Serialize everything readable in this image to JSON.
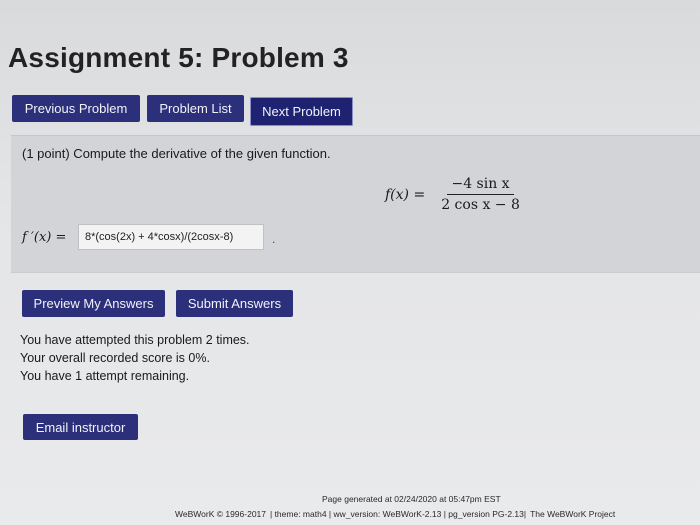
{
  "page": {
    "title": "Assignment 5: Problem 3"
  },
  "nav": {
    "previous": "Previous Problem",
    "list": "Problem List",
    "next": "Next Problem"
  },
  "problem": {
    "prompt": "(1 point) Compute the derivative of the given function.",
    "function_lhs": "f(x) =",
    "numerator": "−4 sin x",
    "denominator": "2 cos x − 8"
  },
  "answer": {
    "label": "f ′(x) =",
    "value": "8*(cos(2x) + 4*cosx)/(2cosx-8)",
    "trailing": "."
  },
  "actions": {
    "preview": "Preview My Answers",
    "submit": "Submit Answers"
  },
  "status": {
    "attempts": "You have attempted this problem 2 times.",
    "score": "Your overall recorded score is 0%.",
    "remaining": "You have 1 attempt remaining."
  },
  "email": {
    "label": "Email instructor"
  },
  "footer": {
    "generated": "Page generated at 02/24/2020 at 05:47pm EST",
    "copyright": "WeBWorK © 1996-2017",
    "theme": "| theme: math4 | ww_version: WeBWorK-2.13 | pg_version PG-2.13|",
    "project": "The WeBWorK Project"
  },
  "colors": {
    "button": "#2c2f7a",
    "button_text": "#f2f2f8",
    "problem_bg": "#d3d4d7"
  }
}
